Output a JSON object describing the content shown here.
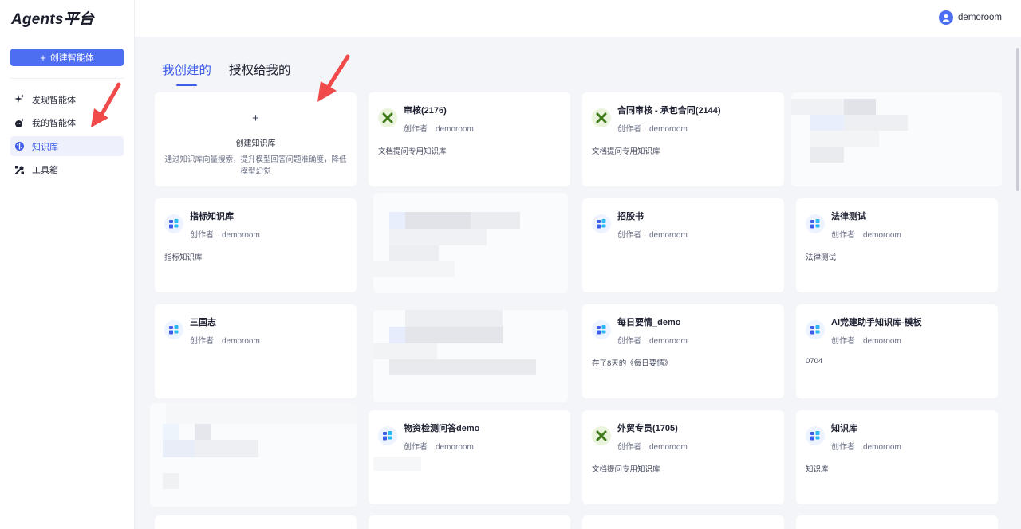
{
  "app": {
    "title": "Agents平台"
  },
  "sidebar": {
    "create_button": {
      "label": "创建智能体",
      "icon": "plus-icon"
    },
    "items": [
      {
        "label": "发现智能体",
        "icon": "sparkle-icon",
        "active": false
      },
      {
        "label": "我的智能体",
        "icon": "agent-icon",
        "active": false
      },
      {
        "label": "知识库",
        "icon": "knowledge-icon",
        "active": true
      },
      {
        "label": "工具箱",
        "icon": "tools-icon",
        "active": false
      }
    ]
  },
  "header": {
    "user": {
      "name": "demoroom",
      "icon": "user-avatar-icon"
    }
  },
  "tabs": [
    {
      "label": "我创建的",
      "active": true
    },
    {
      "label": "授权给我的",
      "active": false
    }
  ],
  "create_card": {
    "title": "创建知识库",
    "description": "通过知识库向量搜索，提升模型回答问题准确度，降低模型幻觉"
  },
  "cards": [
    {
      "title": "审核(2176)",
      "author_label": "创作者",
      "author": "demoroom",
      "desc": "文档提问专用知识库",
      "icon": "excel-icon"
    },
    {
      "title": "合同审核 - 承包合同(2144)",
      "author_label": "创作者",
      "author": "demoroom",
      "desc": "文档提问专用知识库",
      "icon": "excel-icon"
    },
    {
      "title": "指标知识库",
      "author_label": "创作者",
      "author": "demoroom",
      "desc": "指标知识库",
      "icon": "grid-icon"
    },
    {
      "title": "招股书",
      "author_label": "创作者",
      "author": "demoroom",
      "desc": "",
      "icon": "grid-icon"
    },
    {
      "title": "法律测试",
      "author_label": "创作者",
      "author": "demoroom",
      "desc": "法律测试",
      "icon": "grid-icon"
    },
    {
      "title": "三国志",
      "author_label": "创作者",
      "author": "demoroom",
      "desc": "",
      "icon": "grid-icon"
    },
    {
      "title": "每日要情_demo",
      "author_label": "创作者",
      "author": "demoroom",
      "desc": "存了8天的《每日要情》",
      "icon": "grid-icon"
    },
    {
      "title": "AI党建助手知识库-模板",
      "author_label": "创作者",
      "author": "demoroom",
      "desc": "0704",
      "icon": "grid-icon"
    },
    {
      "title": "物资检测问答demo",
      "author_label": "创作者",
      "author": "demoroom",
      "desc": "",
      "icon": "grid-icon"
    },
    {
      "title": "外贸专员(1705)",
      "author_label": "创作者",
      "author": "demoroom",
      "desc": "文档提问专用知识库",
      "icon": "excel-icon"
    },
    {
      "title": "知识库",
      "author_label": "创作者",
      "author": "demoroom",
      "desc": "知识库",
      "icon": "grid-icon"
    }
  ],
  "colors": {
    "accent": "#4e6ef2",
    "active_text": "#3d5ce8",
    "annotation_arrow": "#f04a4a",
    "excel_green": "#3f7a1a"
  }
}
